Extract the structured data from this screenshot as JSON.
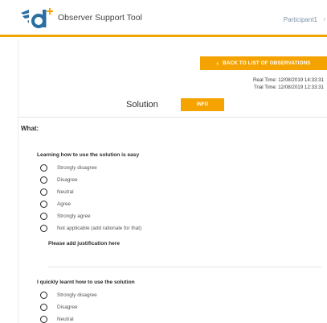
{
  "header": {
    "app_title": "Observer Support Tool",
    "participant_label": "Participant1",
    "accent_color": "#f5a300",
    "logo_color": "#2a6fa3"
  },
  "toolbar": {
    "back_label": "BACK TO LIST OF OBSERVATIONS",
    "real_time": "Real Time: 12/08/2019 14:33:31",
    "trial_time": "Trial Time: 12/08/2019 12:33:31"
  },
  "solution": {
    "label": "Solution",
    "info_label": "INFO"
  },
  "form": {
    "section_label": "What:",
    "questions": [
      {
        "title": "Learning how to use the solution is easy",
        "options": [
          "Strongly disagree",
          "Disagree",
          "Neutral",
          "Agree",
          "Strongly agree",
          "Not applicable (add rationale for that)"
        ],
        "justification_label": "Please add justification here",
        "justification_value": ""
      },
      {
        "title": "I quickly learnt how to use the solution",
        "options": [
          "Strongly disagree",
          "Disagree",
          "Neutral"
        ]
      }
    ]
  }
}
